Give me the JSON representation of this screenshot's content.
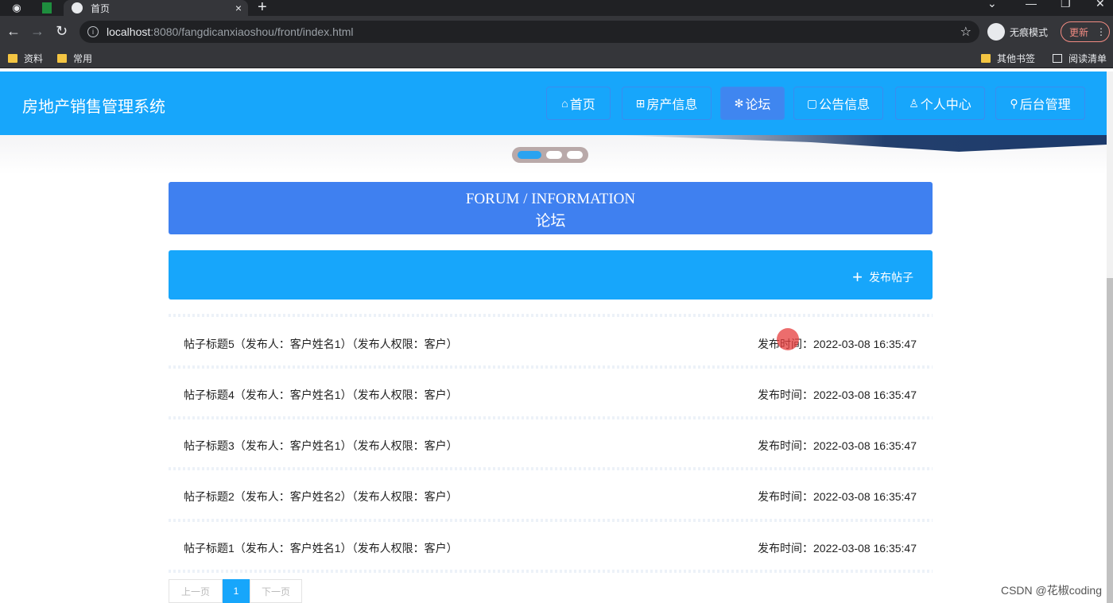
{
  "browser": {
    "tab_title": "首页",
    "tab_close": "×",
    "new_tab": "+",
    "url_host": "localhost",
    "url_path": ":8080/fangdicanxiaoshou/front/index.html",
    "incognito_label": "无痕模式",
    "update_label": "更新",
    "bookmarks": [
      "资料",
      "常用"
    ],
    "other_bookmarks": "其他书签",
    "reading_list": "阅读清单"
  },
  "site": {
    "title": "房地产销售管理系统",
    "nav": [
      {
        "icon": "⌂",
        "label": "首页"
      },
      {
        "icon": "⊞",
        "label": "房产信息"
      },
      {
        "icon": "✻",
        "label": "论坛"
      },
      {
        "icon": "▢",
        "label": "公告信息"
      },
      {
        "icon": "♙",
        "label": "个人中心"
      },
      {
        "icon": "⚲",
        "label": "后台管理"
      }
    ],
    "active_nav": "论坛"
  },
  "forum": {
    "heading_en": "FORUM / INFORMATION",
    "heading_cn": "论坛",
    "post_button": "发布帖子",
    "posts": [
      {
        "title": "帖子标题5（发布人：客户姓名1）（发布人权限：客户）",
        "time": "发布时间：2022-03-08 16:35:47"
      },
      {
        "title": "帖子标题4（发布人：客户姓名1）（发布人权限：客户）",
        "time": "发布时间：2022-03-08 16:35:47"
      },
      {
        "title": "帖子标题3（发布人：客户姓名1）（发布人权限：客户）",
        "time": "发布时间：2022-03-08 16:35:47"
      },
      {
        "title": "帖子标题2（发布人：客户姓名2）（发布人权限：客户）",
        "time": "发布时间：2022-03-08 16:35:47"
      },
      {
        "title": "帖子标题1（发布人：客户姓名1）（发布人权限：客户）",
        "time": "发布时间：2022-03-08 16:35:47"
      }
    ]
  },
  "pager": {
    "prev": "上一页",
    "current": "1",
    "next": "下一页"
  },
  "watermark": "CSDN @花椒coding",
  "colors": {
    "header": "#17a6fb",
    "forum_title_bg": "#3f80f0",
    "active_nav_bg": "#3f86f0"
  }
}
